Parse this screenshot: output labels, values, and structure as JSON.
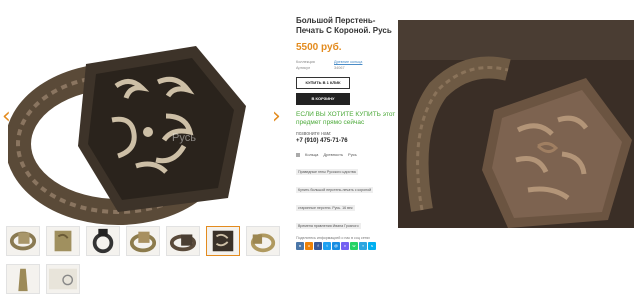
{
  "gallery": {
    "prev_arrow": "‹",
    "next_arrow": "›",
    "watermark": "Русь"
  },
  "product": {
    "title": "Большой Перстень-Печать С Короной. Русь",
    "price": "5500 руб.",
    "meta": [
      {
        "key": "Коллекция",
        "value": "Древние кольца"
      },
      {
        "key": "Артикул",
        "value": "34067"
      }
    ],
    "buy_one_click": "КУПИТЬ В 1 КЛИК",
    "add_to_cart": "В КОРЗИНУ",
    "promo": "ЕСЛИ ВЫ ХОТИТЕ КУПИТЬ этот предмет прямо сейчас",
    "call_label": "позвоните нам:",
    "phone": "+7 (910) 475-71-76",
    "tags": [
      "Кольца",
      "Древность",
      "Русь"
    ],
    "chips": [
      "Праведные гены Русского царства",
      "Купить большой перстень-печать с короной",
      "старинные перстни. Русь. 16 век",
      "Времена правления Ивана Грозного"
    ],
    "share_label": "Поделитесь информацией о нас в соц сетях",
    "socials": [
      {
        "name": "vk",
        "label": "в",
        "color": "#4a76a8"
      },
      {
        "name": "ok",
        "label": "о",
        "color": "#ee8208"
      },
      {
        "name": "fb",
        "label": "f",
        "color": "#3b5998"
      },
      {
        "name": "tw",
        "label": "t",
        "color": "#1da1f2"
      },
      {
        "name": "mr",
        "label": "@",
        "color": "#168de2"
      },
      {
        "name": "vb",
        "label": "v",
        "color": "#7360f2"
      },
      {
        "name": "wa",
        "label": "w",
        "color": "#25d366"
      },
      {
        "name": "tg",
        "label": "т",
        "color": "#2ca5e0"
      },
      {
        "name": "sk",
        "label": "s",
        "color": "#00aff0"
      }
    ]
  }
}
